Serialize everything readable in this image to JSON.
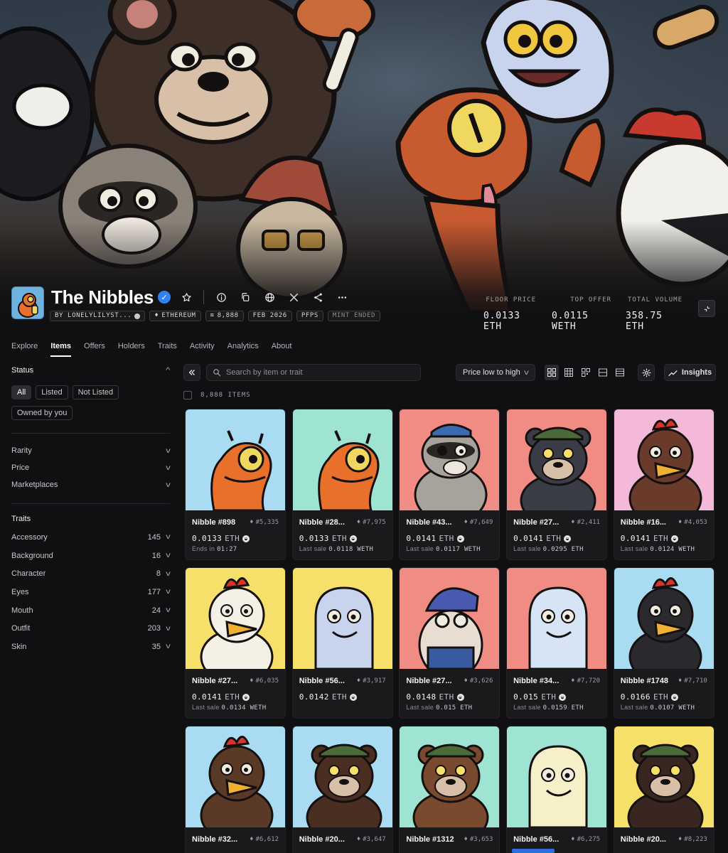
{
  "collection": {
    "name": "The Nibbles",
    "tags": [
      "BY LONELYLILYST...",
      "ETHEREUM",
      "8,888",
      "FEB 2026",
      "PFPS",
      "MINT ENDED"
    ],
    "stats": [
      {
        "label": "FLOOR PRICE",
        "value": "0.0133 ETH"
      },
      {
        "label": "TOP OFFER",
        "value": "0.0115 WETH"
      },
      {
        "label": "TOTAL VOLUME",
        "value": "358.75 ETH"
      }
    ]
  },
  "tabs": [
    "Explore",
    "Items",
    "Offers",
    "Holders",
    "Traits",
    "Activity",
    "Analytics",
    "About"
  ],
  "active_tab": "Items",
  "sidebar": {
    "status_title": "Status",
    "status_pills": [
      "All",
      "Listed",
      "Not Listed"
    ],
    "owned_pill": "Owned by you",
    "filters": [
      "Rarity",
      "Price",
      "Marketplaces"
    ],
    "traits_title": "Traits",
    "traits": [
      {
        "name": "Accessory",
        "count": "145"
      },
      {
        "name": "Background",
        "count": "16"
      },
      {
        "name": "Character",
        "count": "8"
      },
      {
        "name": "Eyes",
        "count": "177"
      },
      {
        "name": "Mouth",
        "count": "24"
      },
      {
        "name": "Outfit",
        "count": "203"
      },
      {
        "name": "Skin",
        "count": "35"
      }
    ]
  },
  "toolbar": {
    "search_placeholder": "Search by item or trait",
    "sort_label": "Price low to high",
    "insights_label": "Insights"
  },
  "item_count": "8,888 ITEMS",
  "items": [
    {
      "name": "Nibble #898",
      "rank": "#5,335",
      "price": "0.0133",
      "currency": "ETH",
      "sub_label": "Ends in",
      "sub_value": "01:27",
      "bg": "#a9dcf2",
      "character": "lizard",
      "body": "#e8702a"
    },
    {
      "name": "Nibble #28...",
      "rank": "#7,975",
      "price": "0.0133",
      "currency": "ETH",
      "sub_label": "Last sale",
      "sub_value": "0.0118 WETH",
      "bg": "#9fe4d2",
      "character": "lizard",
      "body": "#e8702a"
    },
    {
      "name": "Nibble #43...",
      "rank": "#7,649",
      "price": "0.0141",
      "currency": "ETH",
      "sub_label": "Last sale",
      "sub_value": "0.0117 WETH",
      "bg": "#f08c84",
      "character": "raccoon",
      "body": "#a8a39a"
    },
    {
      "name": "Nibble #27...",
      "rank": "#2,411",
      "price": "0.0141",
      "currency": "ETH",
      "sub_label": "Last sale",
      "sub_value": "0.0295 ETH",
      "bg": "#f08c84",
      "character": "bear",
      "body": "#3a3c46"
    },
    {
      "name": "Nibble #16...",
      "rank": "#4,053",
      "price": "0.0141",
      "currency": "ETH",
      "sub_label": "Last sale",
      "sub_value": "0.0124 WETH",
      "bg": "#f4b8d8",
      "character": "bird",
      "body": "#6a3a2a"
    },
    {
      "name": "Nibble #27...",
      "rank": "#6,035",
      "price": "0.0141",
      "currency": "ETH",
      "sub_label": "Last sale",
      "sub_value": "0.0134 WETH",
      "bg": "#f6e06a",
      "character": "bird",
      "body": "#f4f0e6"
    },
    {
      "name": "Nibble #56...",
      "rank": "#3,917",
      "price": "0.0142",
      "currency": "ETH",
      "sub_label": "",
      "sub_value": "",
      "bg": "#f6e06a",
      "character": "ghost",
      "body": "#c8d4ee"
    },
    {
      "name": "Nibble #27...",
      "rank": "#3,626",
      "price": "0.0148",
      "currency": "ETH",
      "sub_label": "Last sale",
      "sub_value": "0.015 ETH",
      "bg": "#f08c84",
      "character": "gnome",
      "body": "#e8ddd0"
    },
    {
      "name": "Nibble #34...",
      "rank": "#7,720",
      "price": "0.015",
      "currency": "ETH",
      "sub_label": "Last sale",
      "sub_value": "0.0159 ETH",
      "bg": "#f08c84",
      "character": "ghost",
      "body": "#d6e4f6"
    },
    {
      "name": "Nibble #1748",
      "rank": "#7,710",
      "price": "0.0166",
      "currency": "ETH",
      "sub_label": "Last sale",
      "sub_value": "0.0107 WETH",
      "bg": "#a9dcf2",
      "character": "bird",
      "body": "#2a2a2e"
    },
    {
      "name": "Nibble #32...",
      "rank": "#6,612",
      "price": "",
      "currency": "",
      "sub_label": "",
      "sub_value": "",
      "bg": "#a9dcf2",
      "character": "bird",
      "body": "#5a3a26"
    },
    {
      "name": "Nibble #20...",
      "rank": "#3,647",
      "price": "",
      "currency": "",
      "sub_label": "",
      "sub_value": "",
      "bg": "#a9dcf2",
      "character": "bear",
      "body": "#4a2e22"
    },
    {
      "name": "Nibble #1312",
      "rank": "#3,653",
      "price": "",
      "currency": "",
      "sub_label": "",
      "sub_value": "",
      "bg": "#9fe4d2",
      "character": "bear",
      "body": "#7a4a2e"
    },
    {
      "name": "Nibble #56...",
      "rank": "#6,275",
      "price": "",
      "currency": "",
      "sub_label": "",
      "sub_value": "",
      "bg": "#9fe4d2",
      "character": "ghost",
      "body": "#f6f0c8"
    },
    {
      "name": "Nibble #20...",
      "rank": "#8,223",
      "price": "",
      "currency": "",
      "sub_label": "",
      "sub_value": "",
      "bg": "#f6e06a",
      "character": "bear",
      "body": "#3a2620"
    }
  ],
  "icons": {
    "verified": "verified-badge-icon",
    "star": "star-icon",
    "info": "info-icon",
    "copy": "copy-icon",
    "globe": "globe-icon",
    "x": "x-logo-icon",
    "share": "share-icon",
    "more": "more-icon"
  },
  "colors": {
    "accent": "#2f83f0",
    "bg": "#101012",
    "card": "#1a1a1d"
  }
}
